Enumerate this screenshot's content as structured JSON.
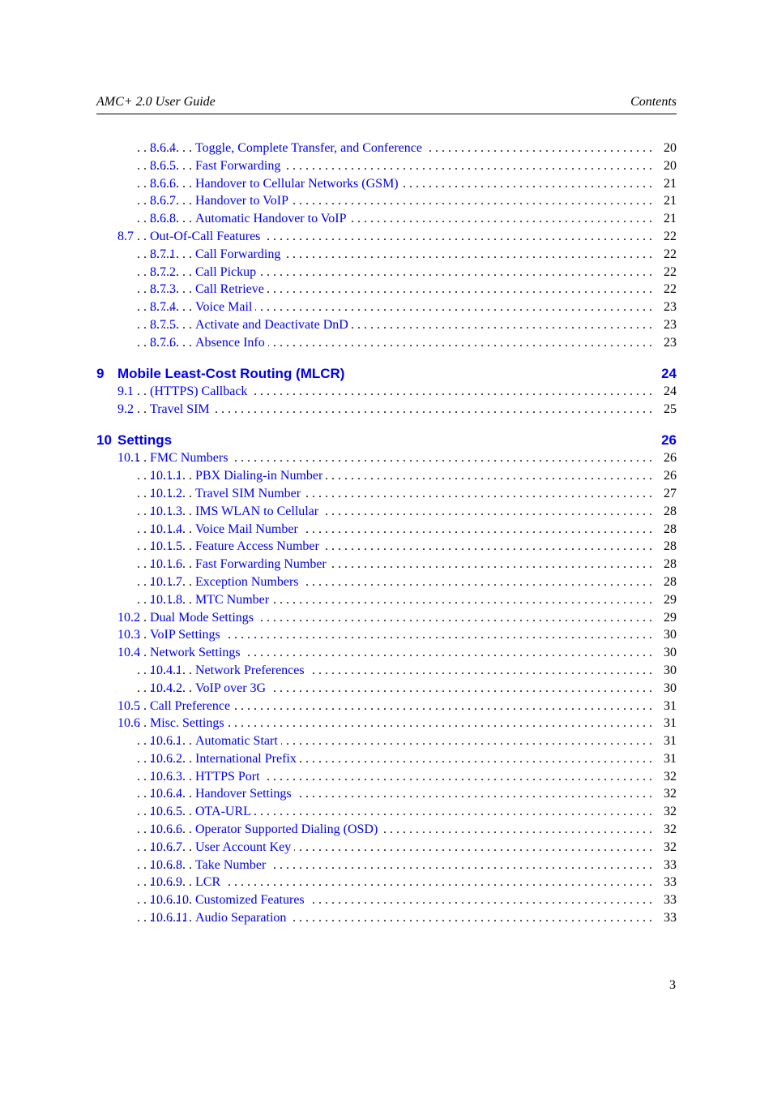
{
  "header": {
    "left": "AMC+ 2.0 User Guide",
    "right": "Contents"
  },
  "link_color": "#0000ee",
  "footer": {
    "page_number": "3"
  },
  "toc": [
    {
      "type": "subsub",
      "num": "8.6.4",
      "title": "Toggle, Complete Transfer, and Conference",
      "page": "20"
    },
    {
      "type": "subsub",
      "num": "8.6.5",
      "title": "Fast Forwarding",
      "page": "20"
    },
    {
      "type": "subsub",
      "num": "8.6.6",
      "title": " Handover to Cellular Networks (GSM)",
      "page": "21"
    },
    {
      "type": "subsub",
      "num": "8.6.7",
      "title": "Handover to VoIP",
      "page": "21"
    },
    {
      "type": "subsub",
      "num": "8.6.8",
      "title": "Automatic Handover to VoIP",
      "page": "21"
    },
    {
      "type": "sub",
      "num": "8.7",
      "title": "Out-Of-Call Features",
      "page": "22"
    },
    {
      "type": "subsub",
      "num": "8.7.1",
      "title": "Call Forwarding",
      "page": "22"
    },
    {
      "type": "subsub",
      "num": "8.7.2",
      "title": "Call Pickup",
      "page": "22"
    },
    {
      "type": "subsub",
      "num": "8.7.3",
      "title": "Call Retrieve",
      "page": "22"
    },
    {
      "type": "subsub",
      "num": "8.7.4",
      "title": "Voice Mail",
      "page": "23"
    },
    {
      "type": "subsub",
      "num": "8.7.5",
      "title": "Activate and Deactivate DnD",
      "page": "23"
    },
    {
      "type": "subsub",
      "num": "8.7.6",
      "title": "Absence Info",
      "page": "23"
    },
    {
      "type": "chapter",
      "num": "9",
      "title": "Mobile Least-Cost Routing (MLCR)",
      "page": "24"
    },
    {
      "type": "sub",
      "num": "9.1",
      "title": "(HTTPS) Callback",
      "page": "24"
    },
    {
      "type": "sub",
      "num": "9.2",
      "title": "Travel SIM",
      "page": "25"
    },
    {
      "type": "chapter",
      "num": "10",
      "title": "Settings",
      "page": "26"
    },
    {
      "type": "sub",
      "num": "10.1",
      "title": "FMC Numbers",
      "page": "26"
    },
    {
      "type": "subsub",
      "num": "10.1.1",
      "title": "PBX Dialing-in Number",
      "page": "26"
    },
    {
      "type": "subsub",
      "num": "10.1.2",
      "title": "Travel SIM Number",
      "page": "27"
    },
    {
      "type": "subsub",
      "num": "10.1.3",
      "title": "IMS WLAN to Cellular",
      "page": "28"
    },
    {
      "type": "subsub",
      "num": "10.1.4",
      "title": "Voice Mail Number",
      "page": "28"
    },
    {
      "type": "subsub",
      "num": "10.1.5",
      "title": "Feature Access Number",
      "page": "28"
    },
    {
      "type": "subsub",
      "num": "10.1.6",
      "title": "Fast Forwarding Number",
      "page": "28"
    },
    {
      "type": "subsub",
      "num": "10.1.7",
      "title": "Exception Numbers",
      "page": "28"
    },
    {
      "type": "subsub",
      "num": "10.1.8",
      "title": "MTC Number",
      "page": "29"
    },
    {
      "type": "sub",
      "num": "10.2",
      "title": "Dual Mode Settings",
      "page": "29"
    },
    {
      "type": "sub",
      "num": "10.3",
      "title": "VoIP Settings",
      "page": "30"
    },
    {
      "type": "sub",
      "num": "10.4",
      "title": "Network Settings",
      "page": "30"
    },
    {
      "type": "subsub",
      "num": "10.4.1",
      "title": "Network Preferences",
      "page": "30"
    },
    {
      "type": "subsub",
      "num": "10.4.2",
      "title": "VoIP over 3G",
      "page": "30"
    },
    {
      "type": "sub",
      "num": "10.5",
      "title": "Call Preference",
      "page": "31"
    },
    {
      "type": "sub",
      "num": "10.6",
      "title": "Misc. Settings",
      "page": "31"
    },
    {
      "type": "subsub",
      "num": "10.6.1",
      "title": "Automatic Start",
      "page": "31"
    },
    {
      "type": "subsub",
      "num": "10.6.2",
      "title": "International Prefix",
      "page": "31"
    },
    {
      "type": "subsub",
      "num": "10.6.3",
      "title": "HTTPS Port",
      "page": "32"
    },
    {
      "type": "subsub",
      "num": "10.6.4",
      "title": "Handover Settings",
      "page": "32"
    },
    {
      "type": "subsub",
      "num": "10.6.5",
      "title": "OTA-URL",
      "page": "32"
    },
    {
      "type": "subsub",
      "num": "10.6.6",
      "title": "Operator Supported Dialing (OSD)",
      "page": "32"
    },
    {
      "type": "subsub",
      "num": "10.6.7",
      "title": "User Account Key",
      "page": "32"
    },
    {
      "type": "subsub",
      "num": "10.6.8",
      "title": "Take Number",
      "page": "33"
    },
    {
      "type": "subsub",
      "num": "10.6.9",
      "title": "LCR",
      "page": "33"
    },
    {
      "type": "subsub",
      "num": "10.6.10",
      "title": "Customized Features",
      "page": "33"
    },
    {
      "type": "subsub",
      "num": "10.6.11",
      "title": "Audio Separation",
      "page": "33"
    }
  ]
}
